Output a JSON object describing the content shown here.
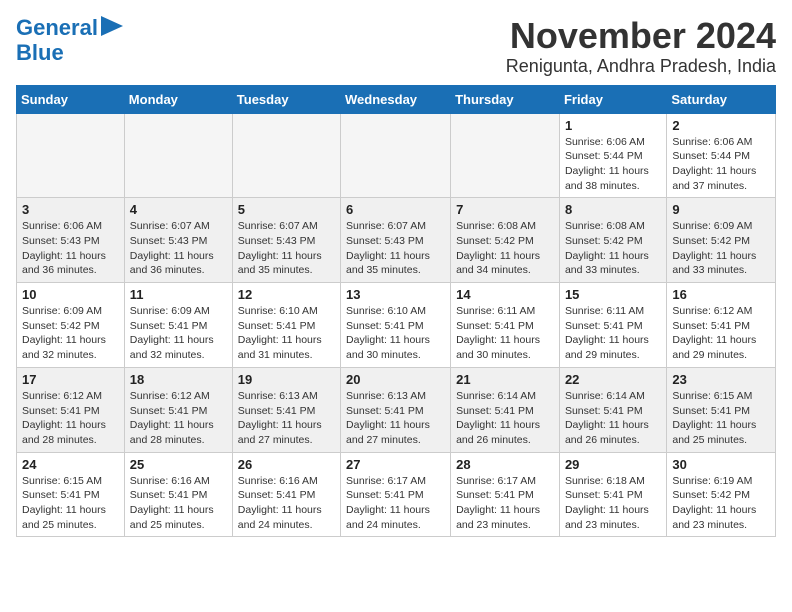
{
  "logo": {
    "line1": "General",
    "line2": "Blue"
  },
  "title": "November 2024",
  "location": "Renigunta, Andhra Pradesh, India",
  "weekdays": [
    "Sunday",
    "Monday",
    "Tuesday",
    "Wednesday",
    "Thursday",
    "Friday",
    "Saturday"
  ],
  "weeks": [
    [
      {
        "day": "",
        "info": ""
      },
      {
        "day": "",
        "info": ""
      },
      {
        "day": "",
        "info": ""
      },
      {
        "day": "",
        "info": ""
      },
      {
        "day": "",
        "info": ""
      },
      {
        "day": "1",
        "info": "Sunrise: 6:06 AM\nSunset: 5:44 PM\nDaylight: 11 hours and 38 minutes."
      },
      {
        "day": "2",
        "info": "Sunrise: 6:06 AM\nSunset: 5:44 PM\nDaylight: 11 hours and 37 minutes."
      }
    ],
    [
      {
        "day": "3",
        "info": "Sunrise: 6:06 AM\nSunset: 5:43 PM\nDaylight: 11 hours and 36 minutes."
      },
      {
        "day": "4",
        "info": "Sunrise: 6:07 AM\nSunset: 5:43 PM\nDaylight: 11 hours and 36 minutes."
      },
      {
        "day": "5",
        "info": "Sunrise: 6:07 AM\nSunset: 5:43 PM\nDaylight: 11 hours and 35 minutes."
      },
      {
        "day": "6",
        "info": "Sunrise: 6:07 AM\nSunset: 5:43 PM\nDaylight: 11 hours and 35 minutes."
      },
      {
        "day": "7",
        "info": "Sunrise: 6:08 AM\nSunset: 5:42 PM\nDaylight: 11 hours and 34 minutes."
      },
      {
        "day": "8",
        "info": "Sunrise: 6:08 AM\nSunset: 5:42 PM\nDaylight: 11 hours and 33 minutes."
      },
      {
        "day": "9",
        "info": "Sunrise: 6:09 AM\nSunset: 5:42 PM\nDaylight: 11 hours and 33 minutes."
      }
    ],
    [
      {
        "day": "10",
        "info": "Sunrise: 6:09 AM\nSunset: 5:42 PM\nDaylight: 11 hours and 32 minutes."
      },
      {
        "day": "11",
        "info": "Sunrise: 6:09 AM\nSunset: 5:41 PM\nDaylight: 11 hours and 32 minutes."
      },
      {
        "day": "12",
        "info": "Sunrise: 6:10 AM\nSunset: 5:41 PM\nDaylight: 11 hours and 31 minutes."
      },
      {
        "day": "13",
        "info": "Sunrise: 6:10 AM\nSunset: 5:41 PM\nDaylight: 11 hours and 30 minutes."
      },
      {
        "day": "14",
        "info": "Sunrise: 6:11 AM\nSunset: 5:41 PM\nDaylight: 11 hours and 30 minutes."
      },
      {
        "day": "15",
        "info": "Sunrise: 6:11 AM\nSunset: 5:41 PM\nDaylight: 11 hours and 29 minutes."
      },
      {
        "day": "16",
        "info": "Sunrise: 6:12 AM\nSunset: 5:41 PM\nDaylight: 11 hours and 29 minutes."
      }
    ],
    [
      {
        "day": "17",
        "info": "Sunrise: 6:12 AM\nSunset: 5:41 PM\nDaylight: 11 hours and 28 minutes."
      },
      {
        "day": "18",
        "info": "Sunrise: 6:12 AM\nSunset: 5:41 PM\nDaylight: 11 hours and 28 minutes."
      },
      {
        "day": "19",
        "info": "Sunrise: 6:13 AM\nSunset: 5:41 PM\nDaylight: 11 hours and 27 minutes."
      },
      {
        "day": "20",
        "info": "Sunrise: 6:13 AM\nSunset: 5:41 PM\nDaylight: 11 hours and 27 minutes."
      },
      {
        "day": "21",
        "info": "Sunrise: 6:14 AM\nSunset: 5:41 PM\nDaylight: 11 hours and 26 minutes."
      },
      {
        "day": "22",
        "info": "Sunrise: 6:14 AM\nSunset: 5:41 PM\nDaylight: 11 hours and 26 minutes."
      },
      {
        "day": "23",
        "info": "Sunrise: 6:15 AM\nSunset: 5:41 PM\nDaylight: 11 hours and 25 minutes."
      }
    ],
    [
      {
        "day": "24",
        "info": "Sunrise: 6:15 AM\nSunset: 5:41 PM\nDaylight: 11 hours and 25 minutes."
      },
      {
        "day": "25",
        "info": "Sunrise: 6:16 AM\nSunset: 5:41 PM\nDaylight: 11 hours and 25 minutes."
      },
      {
        "day": "26",
        "info": "Sunrise: 6:16 AM\nSunset: 5:41 PM\nDaylight: 11 hours and 24 minutes."
      },
      {
        "day": "27",
        "info": "Sunrise: 6:17 AM\nSunset: 5:41 PM\nDaylight: 11 hours and 24 minutes."
      },
      {
        "day": "28",
        "info": "Sunrise: 6:17 AM\nSunset: 5:41 PM\nDaylight: 11 hours and 23 minutes."
      },
      {
        "day": "29",
        "info": "Sunrise: 6:18 AM\nSunset: 5:41 PM\nDaylight: 11 hours and 23 minutes."
      },
      {
        "day": "30",
        "info": "Sunrise: 6:19 AM\nSunset: 5:42 PM\nDaylight: 11 hours and 23 minutes."
      }
    ]
  ]
}
